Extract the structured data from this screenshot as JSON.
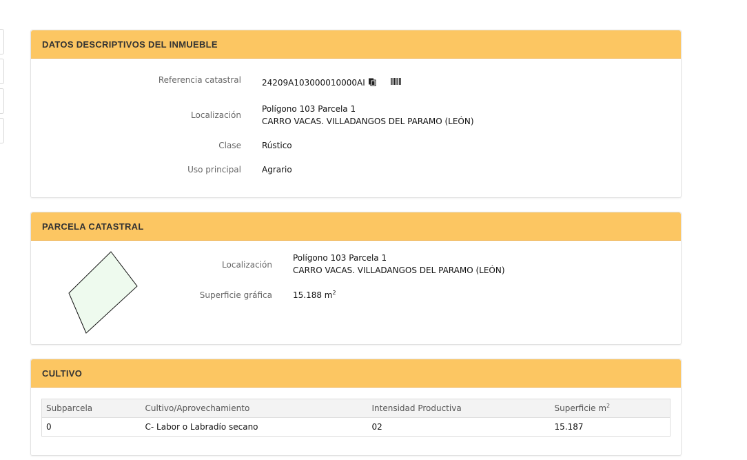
{
  "datos": {
    "title": "DATOS DESCRIPTIVOS DEL INMUEBLE",
    "referencia_label": "Referencia catastral",
    "referencia_value": "24209A103000010000AI",
    "localizacion_label": "Localización",
    "localizacion_line1": "Polígono 103 Parcela 1",
    "localizacion_line2": "CARRO VACAS. VILLADANGOS DEL PARAMO (LEÓN)",
    "clase_label": "Clase",
    "clase_value": "Rústico",
    "uso_label": "Uso principal",
    "uso_value": "Agrario"
  },
  "parcela": {
    "title": "PARCELA CATASTRAL",
    "localizacion_label": "Localización",
    "localizacion_line1": "Polígono 103 Parcela 1",
    "localizacion_line2": "CARRO VACAS. VILLADANGOS DEL PARAMO (LEÓN)",
    "superficie_label": "Superficie gráfica",
    "superficie_value": "15.188 m",
    "superficie_exp": "2",
    "parcel_fill": "#eefaee"
  },
  "cultivo": {
    "title": "CULTIVO",
    "columns": [
      "Subparcela",
      "Cultivo/Aprovechamiento",
      "Intensidad Productiva",
      "Superficie m"
    ],
    "superficie_exp": "2",
    "rows": [
      [
        "0",
        "C- Labor o Labradío secano",
        "02",
        "15.187"
      ]
    ]
  },
  "colors": {
    "header_bg": "#fcc662"
  },
  "icons": [
    "copy-icon",
    "barcode-icon"
  ]
}
